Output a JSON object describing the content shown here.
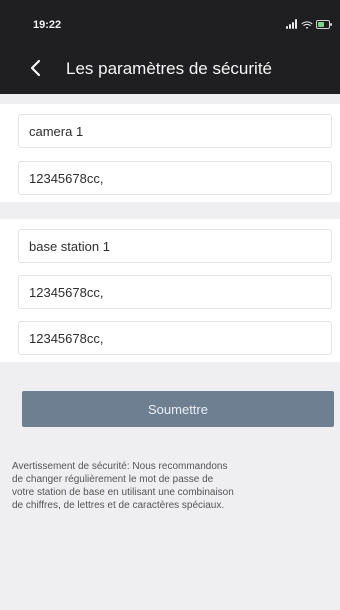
{
  "status_bar": {
    "time": "19:22",
    "icons": [
      "signal-icon",
      "wifi-icon",
      "battery-icon"
    ]
  },
  "header": {
    "title": "Les paramètres de sécurité",
    "back_icon": "chevron-left-icon"
  },
  "section1": {
    "camera_name": "camera 1",
    "camera_password": "12345678cc,"
  },
  "section2": {
    "base_station_name": "base station 1",
    "password": "12345678cc,",
    "password_confirm": "12345678cc,"
  },
  "submit": {
    "label": "Soumettre"
  },
  "warning": {
    "text": "Avertissement de sécurité: Nous recommandons\nde changer régulièrement le mot de passe de\nvotre station de base en utilisant une combinaison\nde chiffres, de lettres et de caractères spéciaux."
  },
  "colors": {
    "header_bg": "#1f1f21",
    "submit_bg": "#6f7f92",
    "page_bg": "#efeff1"
  }
}
